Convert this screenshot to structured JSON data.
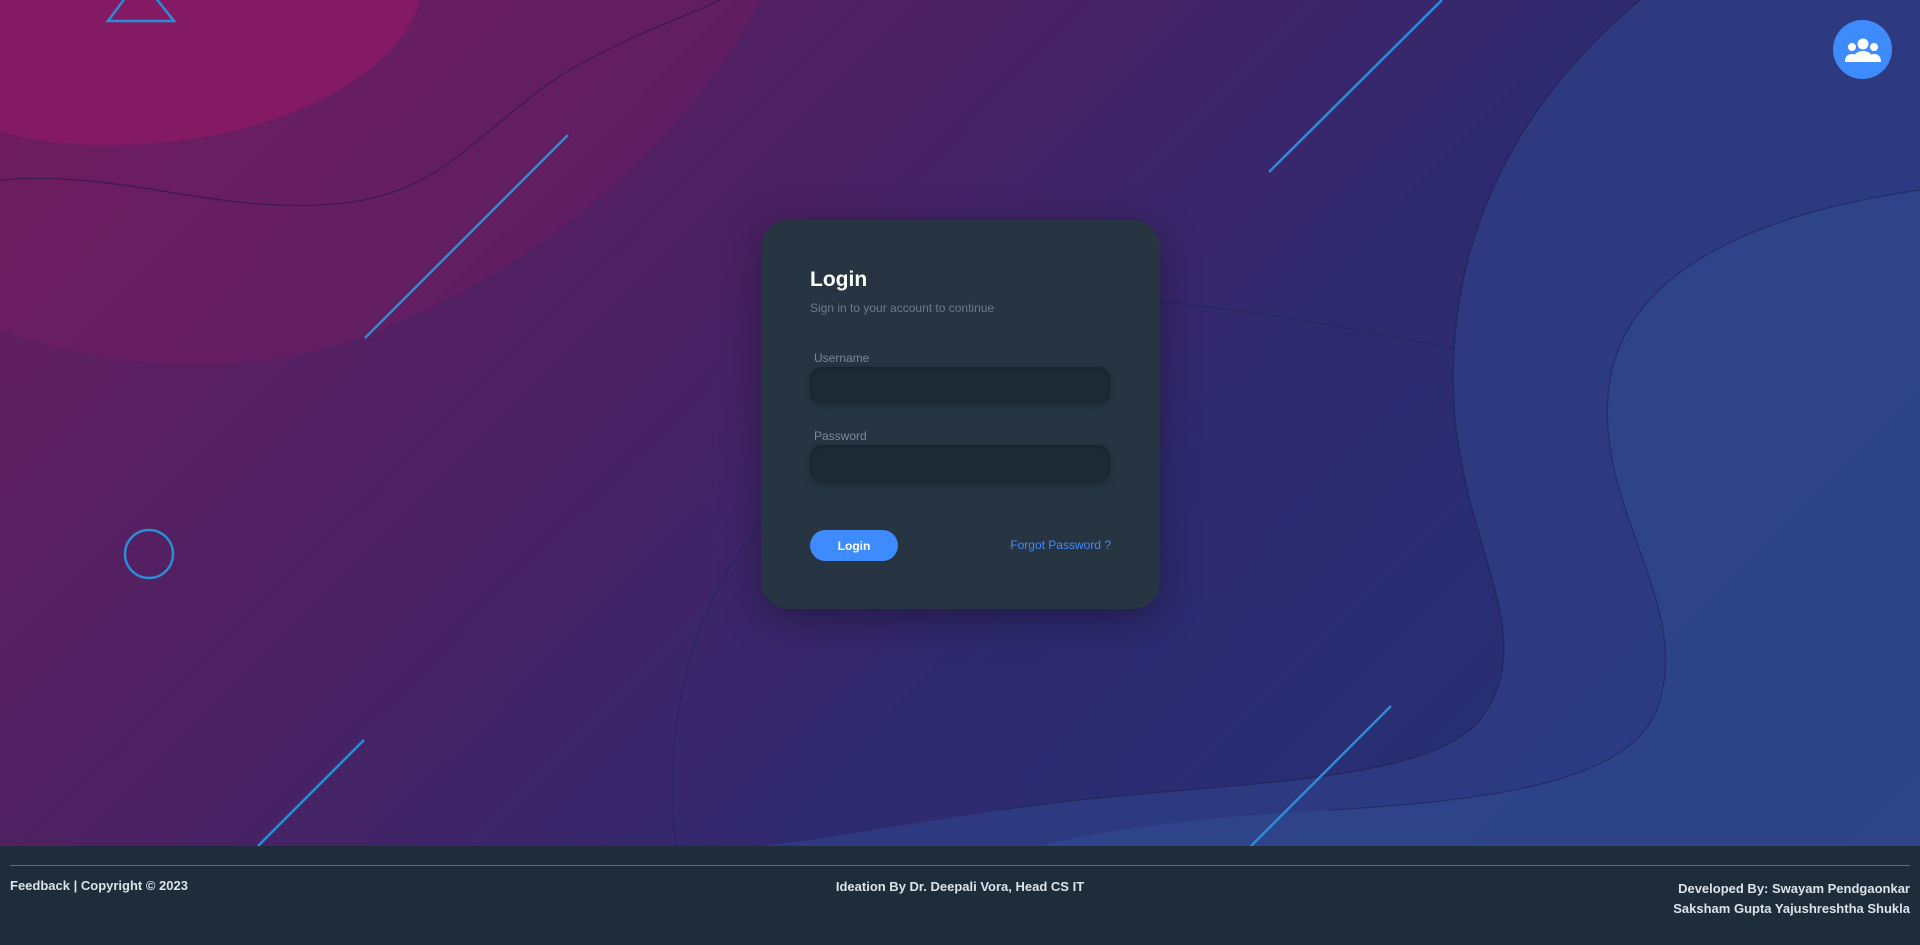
{
  "colors": {
    "accent": "#3d8bfd",
    "card_bg": "#273542",
    "footer_bg": "#1f2d3a",
    "decor_line": "#2a8ed6"
  },
  "header": {
    "user_icon": "users-group-icon"
  },
  "login": {
    "title": "Login",
    "subtitle": "Sign in to your account to continue",
    "username_label": "Username",
    "username_value": "",
    "password_label": "Password",
    "password_value": "",
    "login_button": "Login",
    "forgot_link": "Forgot Password ?"
  },
  "footer": {
    "feedback": "Feedback",
    "separator": " | ",
    "copyright": "Copyright © 2023",
    "ideation": "Ideation By Dr. Deepali Vora, Head CS IT",
    "developed_line1": "Developed By: Swayam Pendgaonkar",
    "developed_line2": "Saksham Gupta Yajushreshtha Shukla"
  }
}
